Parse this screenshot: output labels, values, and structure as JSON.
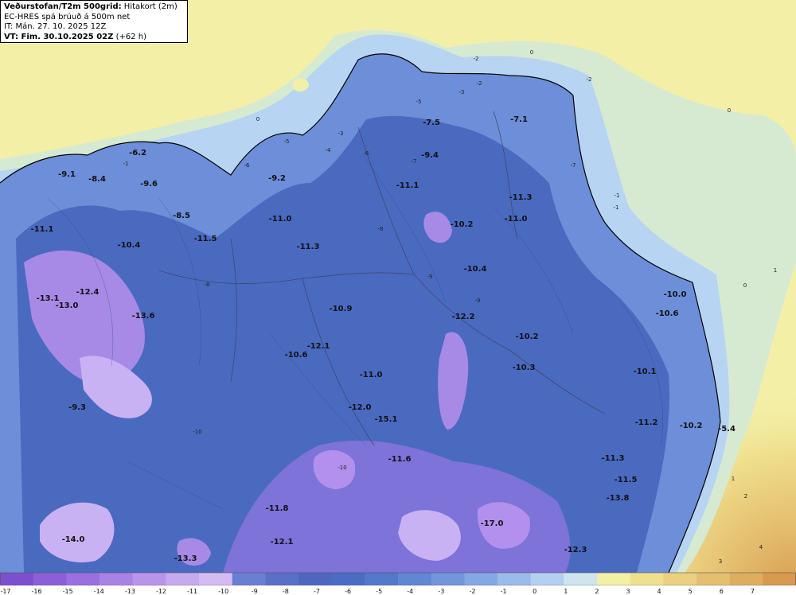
{
  "header": {
    "title_bold": "Veðurstofan/T2m 500grid:",
    "title_suffix": "Hitakort (2m)",
    "line2": "EC-HRES spá brúuð á 500m net",
    "line3": "IT: Mán. 27. 10. 2025 12Z",
    "line4_bold": "VT: Fim. 30.10.2025 02Z",
    "line4_suffix": "(+62 h)"
  },
  "colorbar": {
    "ticks": [
      "-17",
      "-16",
      "-15",
      "-14",
      "-13",
      "-12",
      "-11",
      "-10",
      "-9",
      "-8",
      "-7",
      "-6",
      "-5",
      "-4",
      "-3",
      "-2",
      "-1",
      "0",
      "1",
      "2",
      "3",
      "4",
      "5",
      "6",
      "7"
    ],
    "colors": [
      "#7b4fd0",
      "#8a5fd9",
      "#9a70e0",
      "#a982e6",
      "#b895eb",
      "#c7a9f0",
      "#d4bbf4",
      "#6a7fd4",
      "#5a6fc8",
      "#4f66c0",
      "#4a6cc4",
      "#5478cc",
      "#6186d4",
      "#7196dc",
      "#84a8e4",
      "#9abbec",
      "#b3d0f2",
      "#cfe4ee",
      "#f3efa6",
      "#efe08e",
      "#ead080",
      "#e5bf70",
      "#dfad60",
      "#d99a50"
    ]
  },
  "map": {
    "colors": {
      "sea_warm": "#f3efa6",
      "sea_cool": "#d6ead2",
      "coast_cold": "#b8d4f3",
      "mid_blue": "#6d8ed8",
      "deep_blue": "#4a6ac0",
      "violet": "#a68ae6",
      "light_violet": "#c9b2f4"
    },
    "point_labels": [
      {
        "text": "-9.1"
      },
      {
        "text": "-8.4"
      },
      {
        "text": "-6.2"
      },
      {
        "text": "-9.6"
      },
      {
        "text": "-9.2"
      },
      {
        "text": "-7.5"
      },
      {
        "text": "-7.1"
      },
      {
        "text": "-9.4"
      },
      {
        "text": "-11.1"
      },
      {
        "text": "-11.3"
      },
      {
        "text": "-8.5"
      },
      {
        "text": "-11.0"
      },
      {
        "text": "-10.2"
      },
      {
        "text": "-11.0"
      },
      {
        "text": "-11.1"
      },
      {
        "text": "-11.5"
      },
      {
        "text": "-11.3"
      },
      {
        "text": "-10.4"
      },
      {
        "text": "-10.4"
      },
      {
        "text": "-12.4"
      },
      {
        "text": "-13.1"
      },
      {
        "text": "-13.0"
      },
      {
        "text": "-13.6"
      },
      {
        "text": "-10.9"
      },
      {
        "text": "-12.2"
      },
      {
        "text": "-10.0"
      },
      {
        "text": "-10.6"
      },
      {
        "text": "-10.2"
      },
      {
        "text": "-12.1"
      },
      {
        "text": "-10.6"
      },
      {
        "text": "-10.3"
      },
      {
        "text": "-10.1"
      },
      {
        "text": "-11.0"
      },
      {
        "text": "-9.3"
      },
      {
        "text": "-12.0"
      },
      {
        "text": "-15.1"
      },
      {
        "text": "-11.2"
      },
      {
        "text": "-10.2"
      },
      {
        "text": "-5.4"
      },
      {
        "text": "-11.6"
      },
      {
        "text": "-11.3"
      },
      {
        "text": "-11.5"
      },
      {
        "text": "-13.8"
      },
      {
        "text": "-11.8"
      },
      {
        "text": "-14.0"
      },
      {
        "text": "-17.0"
      },
      {
        "text": "-12.1"
      },
      {
        "text": "-12.3"
      },
      {
        "text": "-13.3"
      }
    ],
    "contour_labels": [
      "0",
      "0",
      "0",
      "-1",
      "-1",
      "-2",
      "-2",
      "-3",
      "-3",
      "-4",
      "-5",
      "-5",
      "-6",
      "-6",
      "-7",
      "-7",
      "-8",
      "-8",
      "-9",
      "-9",
      "-10",
      "-10",
      "1",
      "1",
      "2",
      "3",
      "4",
      "0",
      "-1",
      "-2"
    ]
  }
}
